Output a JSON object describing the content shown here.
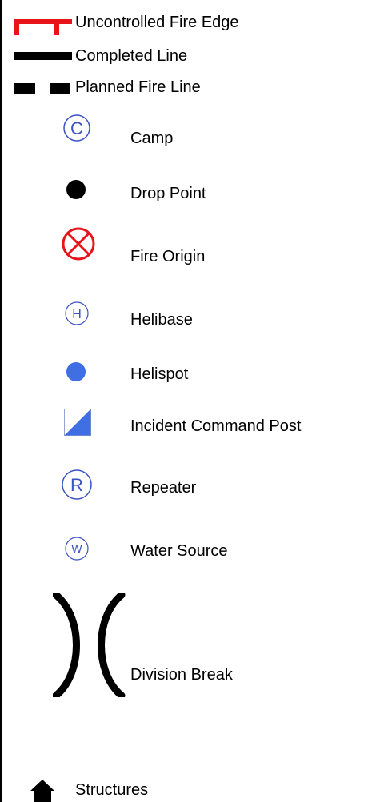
{
  "legend": {
    "uncontrolled_fire_edge": {
      "label": "Uncontrolled Fire Edge",
      "icon": "uncontrolled-fire-edge-icon",
      "color": "#e8141b"
    },
    "completed_line": {
      "label": "Completed Line",
      "icon": "completed-line-icon",
      "color": "#000000"
    },
    "planned_fire_line": {
      "label": "Planned Fire Line",
      "icon": "planned-fire-line-icon",
      "color": "#000000"
    },
    "camp": {
      "label": "Camp",
      "icon": "camp-icon",
      "glyph": "C",
      "color": "#3b52c4"
    },
    "drop_point": {
      "label": "Drop Point",
      "icon": "drop-point-icon",
      "color": "#000000"
    },
    "fire_origin": {
      "label": "Fire Origin",
      "icon": "fire-origin-icon",
      "color": "#e8141b"
    },
    "helibase": {
      "label": "Helibase",
      "icon": "helibase-icon",
      "glyph": "H",
      "color": "#3b52c4"
    },
    "helispot": {
      "label": "Helispot",
      "icon": "helispot-icon",
      "color": "#3f6fe3"
    },
    "incident_command_post": {
      "label": "Incident Command Post",
      "icon": "incident-command-post-icon",
      "color": "#3f6fe3"
    },
    "repeater": {
      "label": "Repeater",
      "icon": "repeater-icon",
      "glyph": "R",
      "color": "#3b52c4"
    },
    "water_source": {
      "label": "Water Source",
      "icon": "water-source-icon",
      "glyph": "W",
      "color": "#3b52c4"
    },
    "division_break": {
      "label": "Division Break",
      "icon": "division-break-icon",
      "color": "#000000"
    },
    "structures": {
      "label": "Structures",
      "icon": "house-icon",
      "color": "#000000"
    }
  }
}
